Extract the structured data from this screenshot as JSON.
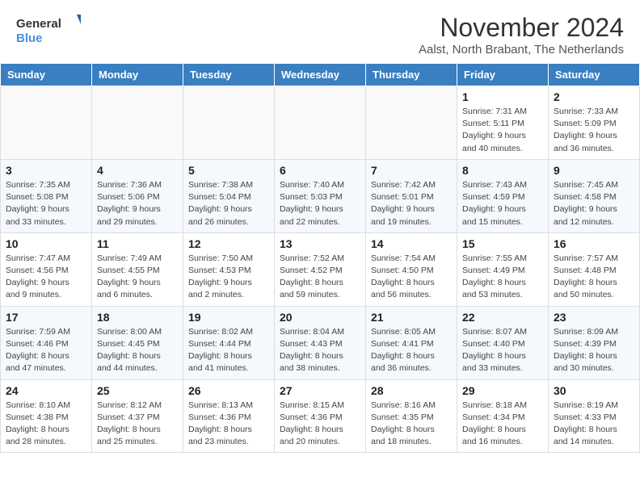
{
  "header": {
    "logo_text_general": "General",
    "logo_text_blue": "Blue",
    "month_title": "November 2024",
    "location": "Aalst, North Brabant, The Netherlands"
  },
  "calendar": {
    "days_of_week": [
      "Sunday",
      "Monday",
      "Tuesday",
      "Wednesday",
      "Thursday",
      "Friday",
      "Saturday"
    ],
    "weeks": [
      [
        {
          "day": "",
          "info": ""
        },
        {
          "day": "",
          "info": ""
        },
        {
          "day": "",
          "info": ""
        },
        {
          "day": "",
          "info": ""
        },
        {
          "day": "",
          "info": ""
        },
        {
          "day": "1",
          "info": "Sunrise: 7:31 AM\nSunset: 5:11 PM\nDaylight: 9 hours\nand 40 minutes."
        },
        {
          "day": "2",
          "info": "Sunrise: 7:33 AM\nSunset: 5:09 PM\nDaylight: 9 hours\nand 36 minutes."
        }
      ],
      [
        {
          "day": "3",
          "info": "Sunrise: 7:35 AM\nSunset: 5:08 PM\nDaylight: 9 hours\nand 33 minutes."
        },
        {
          "day": "4",
          "info": "Sunrise: 7:36 AM\nSunset: 5:06 PM\nDaylight: 9 hours\nand 29 minutes."
        },
        {
          "day": "5",
          "info": "Sunrise: 7:38 AM\nSunset: 5:04 PM\nDaylight: 9 hours\nand 26 minutes."
        },
        {
          "day": "6",
          "info": "Sunrise: 7:40 AM\nSunset: 5:03 PM\nDaylight: 9 hours\nand 22 minutes."
        },
        {
          "day": "7",
          "info": "Sunrise: 7:42 AM\nSunset: 5:01 PM\nDaylight: 9 hours\nand 19 minutes."
        },
        {
          "day": "8",
          "info": "Sunrise: 7:43 AM\nSunset: 4:59 PM\nDaylight: 9 hours\nand 15 minutes."
        },
        {
          "day": "9",
          "info": "Sunrise: 7:45 AM\nSunset: 4:58 PM\nDaylight: 9 hours\nand 12 minutes."
        }
      ],
      [
        {
          "day": "10",
          "info": "Sunrise: 7:47 AM\nSunset: 4:56 PM\nDaylight: 9 hours\nand 9 minutes."
        },
        {
          "day": "11",
          "info": "Sunrise: 7:49 AM\nSunset: 4:55 PM\nDaylight: 9 hours\nand 6 minutes."
        },
        {
          "day": "12",
          "info": "Sunrise: 7:50 AM\nSunset: 4:53 PM\nDaylight: 9 hours\nand 2 minutes."
        },
        {
          "day": "13",
          "info": "Sunrise: 7:52 AM\nSunset: 4:52 PM\nDaylight: 8 hours\nand 59 minutes."
        },
        {
          "day": "14",
          "info": "Sunrise: 7:54 AM\nSunset: 4:50 PM\nDaylight: 8 hours\nand 56 minutes."
        },
        {
          "day": "15",
          "info": "Sunrise: 7:55 AM\nSunset: 4:49 PM\nDaylight: 8 hours\nand 53 minutes."
        },
        {
          "day": "16",
          "info": "Sunrise: 7:57 AM\nSunset: 4:48 PM\nDaylight: 8 hours\nand 50 minutes."
        }
      ],
      [
        {
          "day": "17",
          "info": "Sunrise: 7:59 AM\nSunset: 4:46 PM\nDaylight: 8 hours\nand 47 minutes."
        },
        {
          "day": "18",
          "info": "Sunrise: 8:00 AM\nSunset: 4:45 PM\nDaylight: 8 hours\nand 44 minutes."
        },
        {
          "day": "19",
          "info": "Sunrise: 8:02 AM\nSunset: 4:44 PM\nDaylight: 8 hours\nand 41 minutes."
        },
        {
          "day": "20",
          "info": "Sunrise: 8:04 AM\nSunset: 4:43 PM\nDaylight: 8 hours\nand 38 minutes."
        },
        {
          "day": "21",
          "info": "Sunrise: 8:05 AM\nSunset: 4:41 PM\nDaylight: 8 hours\nand 36 minutes."
        },
        {
          "day": "22",
          "info": "Sunrise: 8:07 AM\nSunset: 4:40 PM\nDaylight: 8 hours\nand 33 minutes."
        },
        {
          "day": "23",
          "info": "Sunrise: 8:09 AM\nSunset: 4:39 PM\nDaylight: 8 hours\nand 30 minutes."
        }
      ],
      [
        {
          "day": "24",
          "info": "Sunrise: 8:10 AM\nSunset: 4:38 PM\nDaylight: 8 hours\nand 28 minutes."
        },
        {
          "day": "25",
          "info": "Sunrise: 8:12 AM\nSunset: 4:37 PM\nDaylight: 8 hours\nand 25 minutes."
        },
        {
          "day": "26",
          "info": "Sunrise: 8:13 AM\nSunset: 4:36 PM\nDaylight: 8 hours\nand 23 minutes."
        },
        {
          "day": "27",
          "info": "Sunrise: 8:15 AM\nSunset: 4:36 PM\nDaylight: 8 hours\nand 20 minutes."
        },
        {
          "day": "28",
          "info": "Sunrise: 8:16 AM\nSunset: 4:35 PM\nDaylight: 8 hours\nand 18 minutes."
        },
        {
          "day": "29",
          "info": "Sunrise: 8:18 AM\nSunset: 4:34 PM\nDaylight: 8 hours\nand 16 minutes."
        },
        {
          "day": "30",
          "info": "Sunrise: 8:19 AM\nSunset: 4:33 PM\nDaylight: 8 hours\nand 14 minutes."
        }
      ]
    ]
  }
}
